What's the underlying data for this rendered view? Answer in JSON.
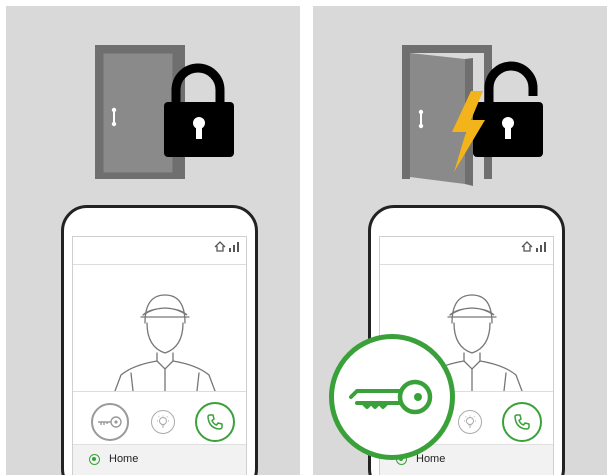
{
  "panels": [
    {
      "state": "locked",
      "illustration_icons": [
        "closed-door-icon",
        "locked-padlock-icon"
      ],
      "phone": {
        "status_icons": [
          "home-icon",
          "signal-bars-icon"
        ],
        "video_subject": "delivery-person-illustration",
        "controls": [
          "key-unlock-button",
          "light-button",
          "call-button"
        ],
        "home_label": "Home"
      }
    },
    {
      "state": "unlocked",
      "illustration_icons": [
        "open-door-icon",
        "lightning-bolt-icon",
        "unlocked-padlock-icon"
      ],
      "phone": {
        "status_icons": [
          "home-icon",
          "signal-bars-icon"
        ],
        "video_subject": "delivery-person-illustration",
        "controls": [
          "key-unlock-button",
          "light-button",
          "call-button"
        ],
        "home_label": "Home"
      },
      "highlight": "key-unlock-icon"
    }
  ],
  "colors": {
    "background": "#d9d9d9",
    "door": "#6f6f6f",
    "padlock": "#000000",
    "lightning": "#f2b31b",
    "accent_green": "#3aa13a"
  }
}
